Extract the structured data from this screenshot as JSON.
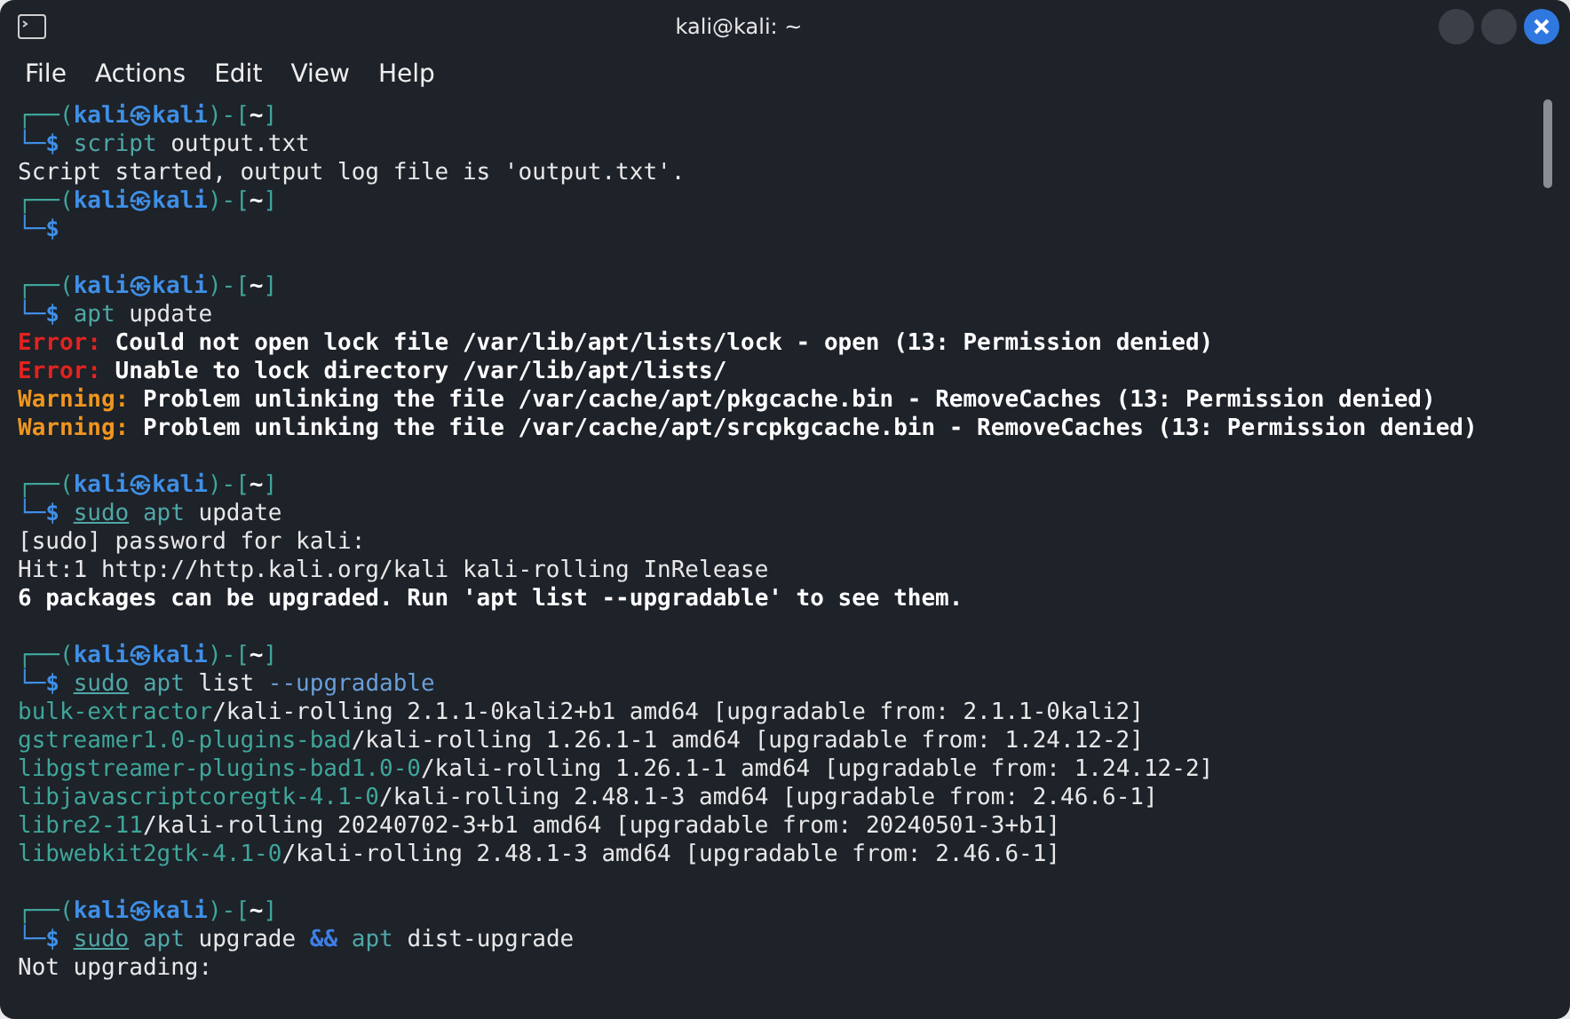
{
  "window": {
    "title": "kali@kali: ~"
  },
  "menu": [
    "File",
    "Actions",
    "Edit",
    "View",
    "Help"
  ],
  "lines": [
    {
      "kind": "prompt",
      "frame": "┌──(",
      "user": "kali㉿kali",
      "sep": ")-[",
      "dir": "~",
      "close": "]"
    },
    {
      "kind": "command",
      "marker": "└─$",
      "tokens": [
        {
          "text": "script",
          "kind": "cmd"
        },
        {
          "text": "output.txt",
          "kind": "arg"
        }
      ]
    },
    {
      "kind": "output",
      "text": "Script started, output log file is 'output.txt'."
    },
    {
      "kind": "prompt",
      "frame": "┌──(",
      "user": "kali㉿kali",
      "sep": ")-[",
      "dir": "~",
      "close": "]"
    },
    {
      "kind": "command",
      "marker": "└─$"
    },
    {
      "kind": "blank"
    },
    {
      "kind": "prompt",
      "frame": "┌──(",
      "user": "kali㉿kali",
      "sep": ")-[",
      "dir": "~",
      "close": "]"
    },
    {
      "kind": "command",
      "marker": "└─$",
      "tokens": [
        {
          "text": "apt",
          "kind": "cmd"
        },
        {
          "text": "update",
          "kind": "arg"
        }
      ]
    },
    {
      "kind": "error",
      "label": "Error:",
      "text": "Could not open lock file /var/lib/apt/lists/lock - open (13: Permission denied)"
    },
    {
      "kind": "error",
      "label": "Error:",
      "text": "Unable to lock directory /var/lib/apt/lists/"
    },
    {
      "kind": "warning",
      "label": "Warning:",
      "text": "Problem unlinking the file /var/cache/apt/pkgcache.bin - RemoveCaches (13: Permission denied)"
    },
    {
      "kind": "warning",
      "label": "Warning:",
      "text": "Problem unlinking the file /var/cache/apt/srcpkgcache.bin - RemoveCaches (13: Permission denied)"
    },
    {
      "kind": "blank"
    },
    {
      "kind": "prompt",
      "frame": "┌──(",
      "user": "kali㉿kali",
      "sep": ")-[",
      "dir": "~",
      "close": "]"
    },
    {
      "kind": "command",
      "marker": "└─$",
      "tokens": [
        {
          "text": "sudo",
          "kind": "cmd",
          "underline": true
        },
        {
          "text": "apt",
          "kind": "cmd"
        },
        {
          "text": "update",
          "kind": "arg"
        }
      ]
    },
    {
      "kind": "output",
      "text": "[sudo] password for kali:"
    },
    {
      "kind": "output",
      "text": "Hit:1 http://http.kali.org/kali kali-rolling InRelease"
    },
    {
      "kind": "bold",
      "text": "6 packages can be upgraded. Run 'apt list --upgradable' to see them."
    },
    {
      "kind": "blank"
    },
    {
      "kind": "prompt",
      "frame": "┌──(",
      "user": "kali㉿kali",
      "sep": ")-[",
      "dir": "~",
      "close": "]"
    },
    {
      "kind": "command",
      "marker": "└─$",
      "tokens": [
        {
          "text": "sudo",
          "kind": "cmd",
          "underline": true
        },
        {
          "text": "apt",
          "kind": "cmd"
        },
        {
          "text": "list",
          "kind": "arg"
        },
        {
          "text": "--upgradable",
          "kind": "option"
        }
      ]
    },
    {
      "kind": "package",
      "name": "bulk-extractor",
      "text": "/kali-rolling 2.1.1-0kali2+b1 amd64 [upgradable from: 2.1.1-0kali2]"
    },
    {
      "kind": "package",
      "name": "gstreamer1.0-plugins-bad",
      "text": "/kali-rolling 1.26.1-1 amd64 [upgradable from: 1.24.12-2]"
    },
    {
      "kind": "package",
      "name": "libgstreamer-plugins-bad1.0-0",
      "text": "/kali-rolling 1.26.1-1 amd64 [upgradable from: 1.24.12-2]"
    },
    {
      "kind": "package",
      "name": "libjavascriptcoregtk-4.1-0",
      "text": "/kali-rolling 2.48.1-3 amd64 [upgradable from: 2.46.6-1]"
    },
    {
      "kind": "package",
      "name": "libre2-11",
      "text": "/kali-rolling 20240702-3+b1 amd64 [upgradable from: 20240501-3+b1]"
    },
    {
      "kind": "package",
      "name": "libwebkit2gtk-4.1-0",
      "text": "/kali-rolling 2.48.1-3 amd64 [upgradable from: 2.46.6-1]"
    },
    {
      "kind": "blank"
    },
    {
      "kind": "prompt",
      "frame": "┌──(",
      "user": "kali㉿kali",
      "sep": ")-[",
      "dir": "~",
      "close": "]"
    },
    {
      "kind": "command",
      "marker": "└─$",
      "tokens": [
        {
          "text": "sudo",
          "kind": "cmd",
          "underline": true
        },
        {
          "text": "apt",
          "kind": "cmd"
        },
        {
          "text": "upgrade",
          "kind": "arg"
        },
        {
          "text": "&&",
          "kind": "operator"
        },
        {
          "text": "apt",
          "kind": "cmd"
        },
        {
          "text": "dist-upgrade",
          "kind": "arg"
        }
      ]
    },
    {
      "kind": "output",
      "text": "Not upgrading:"
    }
  ]
}
